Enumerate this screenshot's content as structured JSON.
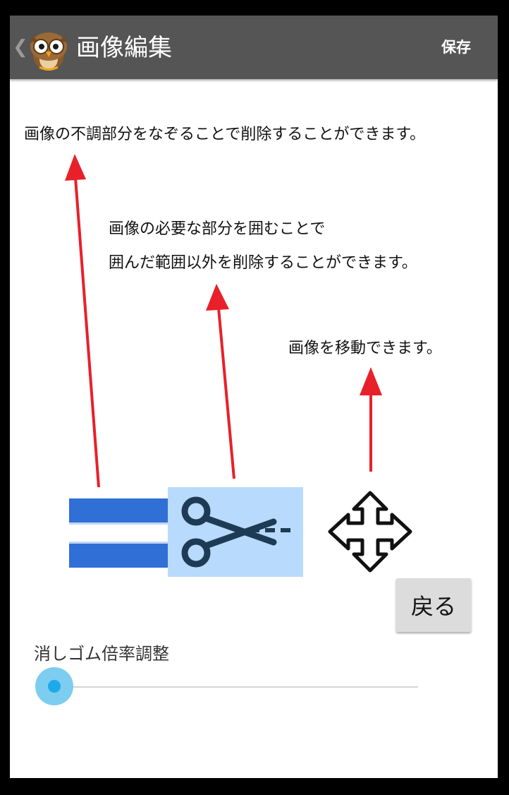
{
  "app_bar": {
    "back_glyph": "❮",
    "title": "画像編集",
    "save_label": "保存",
    "background_color": "#555555",
    "logo_icon": "owl-mascot-icon"
  },
  "instructions": {
    "eraser_note": "画像の不調部分をなぞることで削除することができます。",
    "crop_note_line1": "画像の必要な部分を囲むことで",
    "crop_note_line2": "囲んだ範囲以外を削除することができます。",
    "move_note": "画像を移動できます。",
    "arrow_color": "#e8202a"
  },
  "tools": [
    {
      "name": "eraser",
      "icon": "eraser-stripes-icon",
      "colors": [
        "#2f6fd6",
        "#ffffff"
      ]
    },
    {
      "name": "crop",
      "icon": "scissors-icon",
      "highlight_color": "#b8dafc",
      "selected": true
    },
    {
      "name": "move",
      "icon": "move-arrows-icon"
    }
  ],
  "back_button": {
    "label": "戻る"
  },
  "eraser_scale": {
    "label": "消しゴム倍率調整",
    "value": 0,
    "accent_color": "#1ea9e8"
  }
}
